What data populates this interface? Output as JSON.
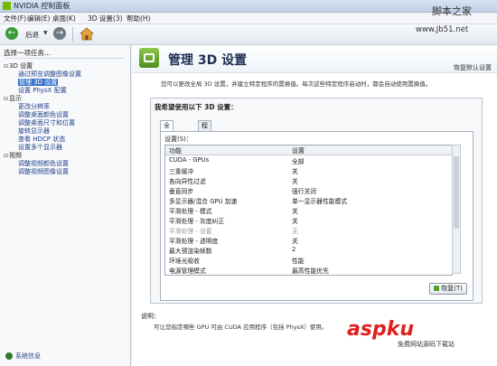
{
  "window": {
    "title": "NVIDIA 控制面板"
  },
  "menu": [
    "文件(F)",
    "编辑(E)",
    "桌面(K)",
    "3D 设置(3)",
    "帮助(H)"
  ],
  "toolbar": {
    "back_label": "后退",
    "back_icon": "back-arrow-icon",
    "forward_icon": "forward-arrow-icon",
    "home_icon": "home-icon"
  },
  "sidebar": {
    "header": "选择一项任务...",
    "items": [
      {
        "label": "3D 设置",
        "type": "category"
      },
      {
        "label": "通过预览调整图像设置",
        "type": "task"
      },
      {
        "label": "管理 3D 设置",
        "type": "task",
        "selected": true
      },
      {
        "label": "设置 PhysX 配置",
        "type": "task"
      },
      {
        "label": "显示",
        "type": "category"
      },
      {
        "label": "更改分辨率",
        "type": "task"
      },
      {
        "label": "调整桌面颜色设置",
        "type": "task"
      },
      {
        "label": "调整桌面尺寸和位置",
        "type": "task"
      },
      {
        "label": "旋转显示器",
        "type": "task"
      },
      {
        "label": "查看 HDCP 状态",
        "type": "task"
      },
      {
        "label": "设置多个显示器",
        "type": "task"
      },
      {
        "label": "视频",
        "type": "category"
      },
      {
        "label": "调整视频颜色设置",
        "type": "task"
      },
      {
        "label": "调整视频图像设置",
        "type": "task"
      }
    ],
    "footer_link": "系统信息"
  },
  "main": {
    "title": "管理 3D 设置",
    "restore_defaults": "恢复默认设置",
    "description": "您可以更改全局 3D 设置，并建立特定程序的置换值。每次这些特定程序启动时，都会自动使用置换值。",
    "group_title": "我希望使用以下 3D 设置：",
    "tabs": [
      "全局设置",
      "程序设置"
    ],
    "active_tab": 0,
    "settings_label": "设置(S)：",
    "columns": [
      "功能",
      "设置"
    ],
    "rows": [
      {
        "feature": "CUDA - GPUs",
        "value": "全部",
        "disabled": false
      },
      {
        "feature": "三重缓冲",
        "value": "关",
        "disabled": false
      },
      {
        "feature": "各向异性过滤",
        "value": "关",
        "disabled": false
      },
      {
        "feature": "垂直同步",
        "value": "强行关闭",
        "disabled": false
      },
      {
        "feature": "多显示器/混合 GPU 加速",
        "value": "单一显示器性能模式",
        "disabled": false
      },
      {
        "feature": "平滑处理 - 模式",
        "value": "关",
        "disabled": false
      },
      {
        "feature": "平滑处理 - 灰度纠正",
        "value": "关",
        "disabled": false
      },
      {
        "feature": "平滑处理 - 设置",
        "value": "无",
        "disabled": true
      },
      {
        "feature": "平滑处理 - 透明度",
        "value": "关",
        "disabled": false
      },
      {
        "feature": "最大预渲染帧数",
        "value": "2",
        "disabled": false
      },
      {
        "feature": "环境光吸收",
        "value": "性能",
        "disabled": false
      },
      {
        "feature": "电源管理模式",
        "value": "最高性能优先",
        "disabled": false
      }
    ],
    "restore_button": "恢复(T)"
  },
  "help": {
    "title": "说明：",
    "text": "可让您指定哪些 GPU 可由 CUDA 应用程序（包括 PhysX）使用。"
  },
  "watermarks": {
    "site_cn": "脚本之家",
    "site_url": "www.Jb51.net",
    "asp_logo": "aspku",
    "asp_sub": "免费网站源码下载站"
  }
}
